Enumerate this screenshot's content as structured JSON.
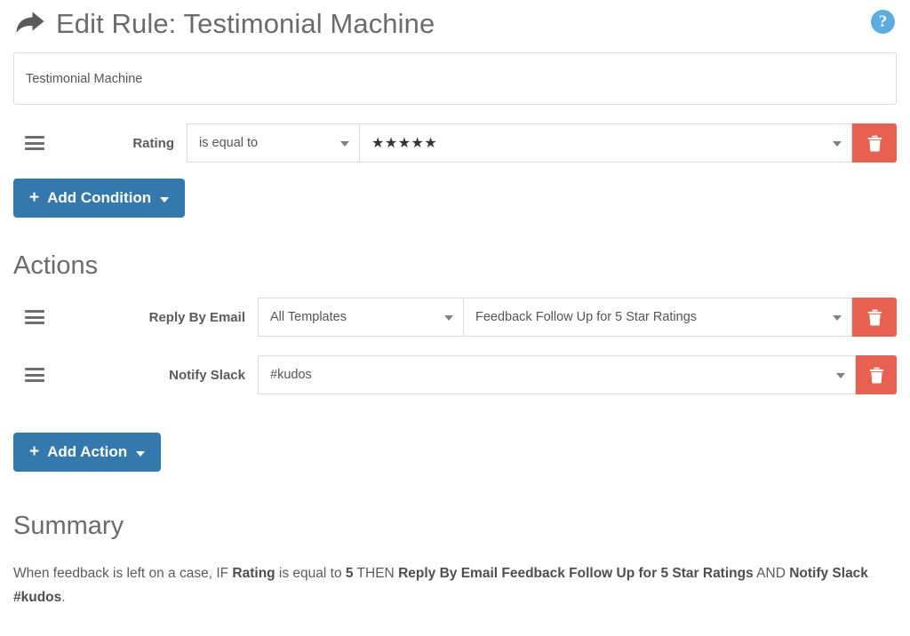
{
  "header": {
    "icon": "share-arrow-icon",
    "title": "Edit Rule: Testimonial Machine",
    "help_icon": "question-mark-icon",
    "help_label": "?"
  },
  "rule_name": {
    "value": "Testimonial Machine",
    "placeholder": "Rule name"
  },
  "conditions": {
    "rows": [
      {
        "drag_handle": "drag-handle-icon",
        "label": "Rating",
        "operator": "is equal to",
        "value": "★★★★★",
        "value_numeric": "5",
        "delete_icon": "trash-icon"
      }
    ],
    "add_button": {
      "plus": "+",
      "label": "Add Condition"
    }
  },
  "actions": {
    "heading": "Actions",
    "rows": [
      {
        "drag_handle": "drag-handle-icon",
        "label": "Reply By Email",
        "select_one": "All Templates",
        "select_two": "Feedback Follow Up for 5 Star Ratings",
        "delete_icon": "trash-icon"
      },
      {
        "drag_handle": "drag-handle-icon",
        "label": "Notify Slack",
        "select_one": "#kudos",
        "delete_icon": "trash-icon"
      }
    ],
    "add_button": {
      "plus": "+",
      "label": "Add Action"
    }
  },
  "summary": {
    "heading": "Summary",
    "parts": {
      "intro": "When feedback is left on a case, IF ",
      "condition_field": "Rating",
      "operator": " is equal to ",
      "condition_value": "5",
      "then": " THEN ",
      "action_one": "Reply By Email Feedback Follow Up for 5 Star Ratings",
      "conjunction": " AND ",
      "action_two": "Notify Slack #kudos",
      "period": "."
    }
  },
  "colors": {
    "primary_blue": "#3479ae",
    "danger_red": "#e8604f",
    "help_blue": "#5bacdf",
    "border_grey": "#dcdcdc",
    "text_grey": "#5b5b5b",
    "heading_grey": "#6b6b6b"
  }
}
